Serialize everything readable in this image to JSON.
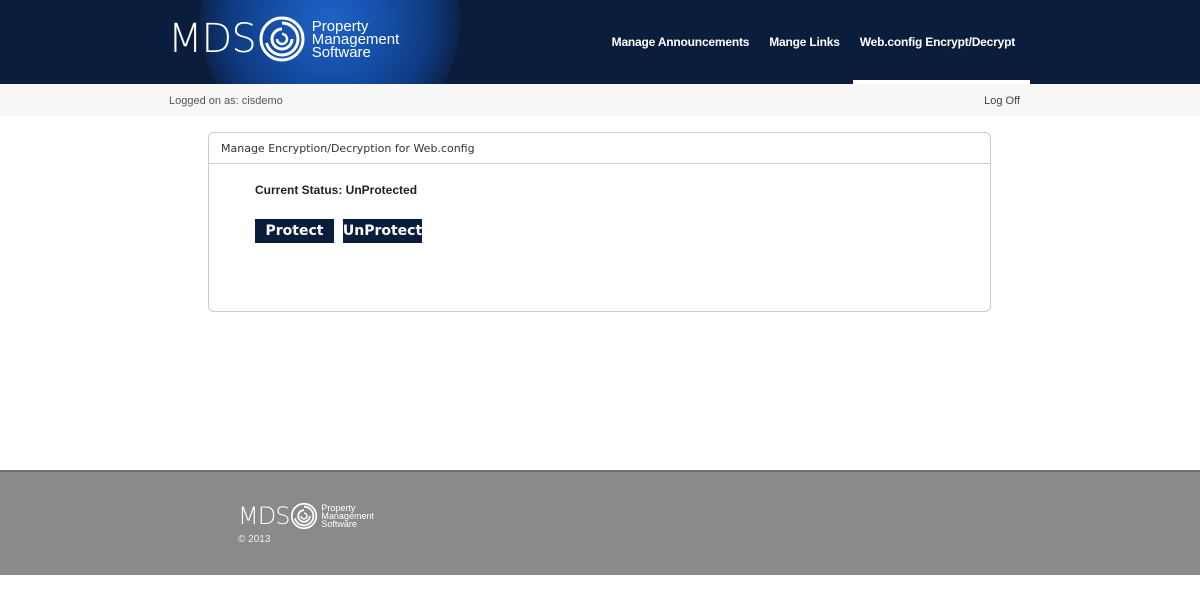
{
  "brand": {
    "mds": "MDS",
    "tagline": [
      "Property",
      "Management",
      "Software"
    ]
  },
  "nav": {
    "items": [
      {
        "label": "Manage Announcements"
      },
      {
        "label": "Mange Links"
      },
      {
        "label": "Web.config Encrypt/Decrypt"
      }
    ]
  },
  "subbar": {
    "logged_on": "Logged on as: cisdemo",
    "logoff": "Log Off"
  },
  "panel": {
    "title": "Manage Encryption/Decryption for Web.config",
    "status": "Current Status: UnProtected",
    "protect_label": "Protect",
    "unprotect_label": "UnProtect"
  },
  "footer": {
    "copyright": "© 2013"
  },
  "colors": {
    "header_bg": "#0b1d3d",
    "button_bg": "#0b1d3d",
    "footer_bg": "#8a8a8a"
  }
}
